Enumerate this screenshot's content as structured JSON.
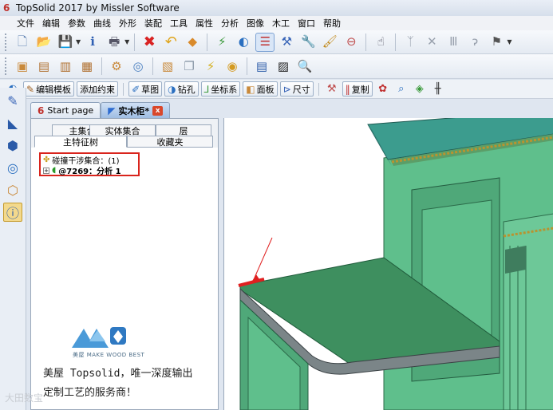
{
  "window": {
    "title": "TopSolid 2017 by Missler Software",
    "logo_glyph": "6"
  },
  "menu": [
    "文件",
    "编辑",
    "参数",
    "曲线",
    "外形",
    "装配",
    "工具",
    "属性",
    "分析",
    "图像",
    "木工",
    "窗口",
    "帮助"
  ],
  "toolbar3": {
    "edit_template": "编辑模板",
    "add_constraint": "添加约束",
    "sketch": "草图",
    "drill": "钻孔",
    "coord_system": "坐标系",
    "panel": "面板",
    "dimension": "尺寸",
    "copy": "复制"
  },
  "doc_tabs": {
    "start": "Start page",
    "active": "实木柜*",
    "close": "x"
  },
  "panel_tabs": {
    "main_set": "主集合",
    "solid_set": "实体集合",
    "layer": "层",
    "main_tree": "主特征树",
    "favorites": "收藏夹"
  },
  "tree": {
    "row1": "碰撞干涉集合：(1)",
    "row2": "@7269：分析 1",
    "expand": "+"
  },
  "brand": {
    "sub": "美屋 MAKE WOOD BEST"
  },
  "ad": {
    "line1": "美屋 Topsolid，唯一深度输出",
    "line2": "定制工艺的服务商！"
  },
  "watermark": "大田数宝"
}
